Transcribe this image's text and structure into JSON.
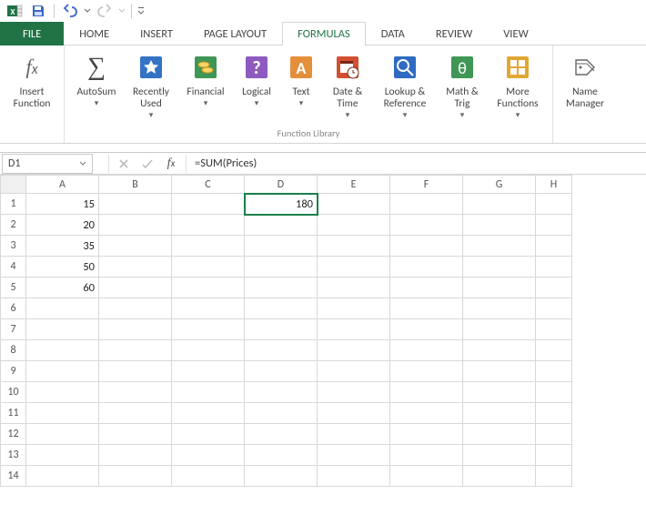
{
  "qat": {
    "undo_tip": "Undo",
    "redo_tip": "Redo"
  },
  "tabs": {
    "file": "FILE",
    "items": [
      "HOME",
      "INSERT",
      "PAGE LAYOUT",
      "FORMULAS",
      "DATA",
      "REVIEW",
      "VIEW"
    ],
    "active_index": 3
  },
  "ribbon": {
    "group1_title": "",
    "group_lib_title": "Function Library",
    "buttons": {
      "insert_function": "Insert\nFunction",
      "autosum": "AutoSum",
      "recent": "Recently\nUsed",
      "financial": "Financial",
      "logical": "Logical",
      "text": "Text",
      "date_time": "Date &\nTime",
      "lookup": "Lookup &\nReference",
      "math": "Math &\nTrig",
      "more": "More\nFunctions",
      "name_mgr": "Name\nManager"
    }
  },
  "formula_bar": {
    "namebox": "D1",
    "formula": "=SUM(Prices)"
  },
  "sheet": {
    "columns": [
      "A",
      "B",
      "C",
      "D",
      "E",
      "F",
      "G",
      "H"
    ],
    "row_count": 14,
    "cells": {
      "A1": "15",
      "A2": "20",
      "A3": "35",
      "A4": "50",
      "A5": "60",
      "D1": "180"
    },
    "selected": "D1"
  }
}
